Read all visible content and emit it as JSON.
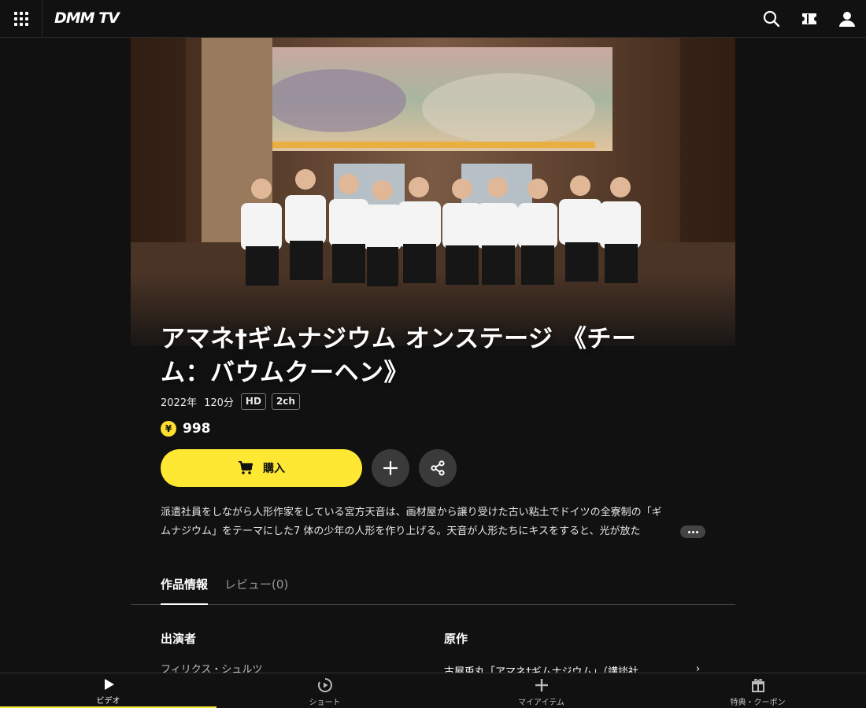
{
  "header": {
    "logo": "DMM TV",
    "icons": [
      "apps-grid-icon",
      "search-icon",
      "ticket-icon",
      "user-icon"
    ]
  },
  "title": "アマネ†ギムナジウム オンステージ 《チーム：バウムクーヘン》",
  "meta": {
    "year": "2022年",
    "duration": "120分",
    "tags": [
      "HD",
      "2ch"
    ]
  },
  "price": {
    "currency_symbol": "¥",
    "value": "998"
  },
  "actions": {
    "buy_label": "購入",
    "add_icon": "plus-icon",
    "share_icon": "share-icon"
  },
  "description": {
    "line1": "派遣社員をしながら人形作家をしている宮方天音は、画材屋から譲り受けた古い粘土でドイツの全寮制の「ギ",
    "line2": "ムナジウム」をテーマにした7 体の少年の人形を作り上げる。天音が人形たちにキスをすると、光が放た"
  },
  "tabs": [
    {
      "label": "作品情報",
      "active": true
    },
    {
      "label": "レビュー(0)",
      "active": false
    }
  ],
  "info": {
    "cast_heading": "出演者",
    "cast_first": "フィリクス・シュルツ",
    "original_heading": "原作",
    "original_text": "古屋兎丸「アマネ†ギムナジウム」（講談社…",
    "chevron": "›"
  },
  "bottom_nav": [
    {
      "label": "ビデオ",
      "icon": "play-icon",
      "active": true
    },
    {
      "label": "ショート",
      "icon": "short-play-icon",
      "active": false
    },
    {
      "label": "マイアイテム",
      "icon": "plus-icon",
      "active": false
    },
    {
      "label": "特典・クーポン",
      "icon": "gift-icon",
      "active": false
    }
  ],
  "colors": {
    "accent": "#ffe833",
    "background": "#111111"
  }
}
